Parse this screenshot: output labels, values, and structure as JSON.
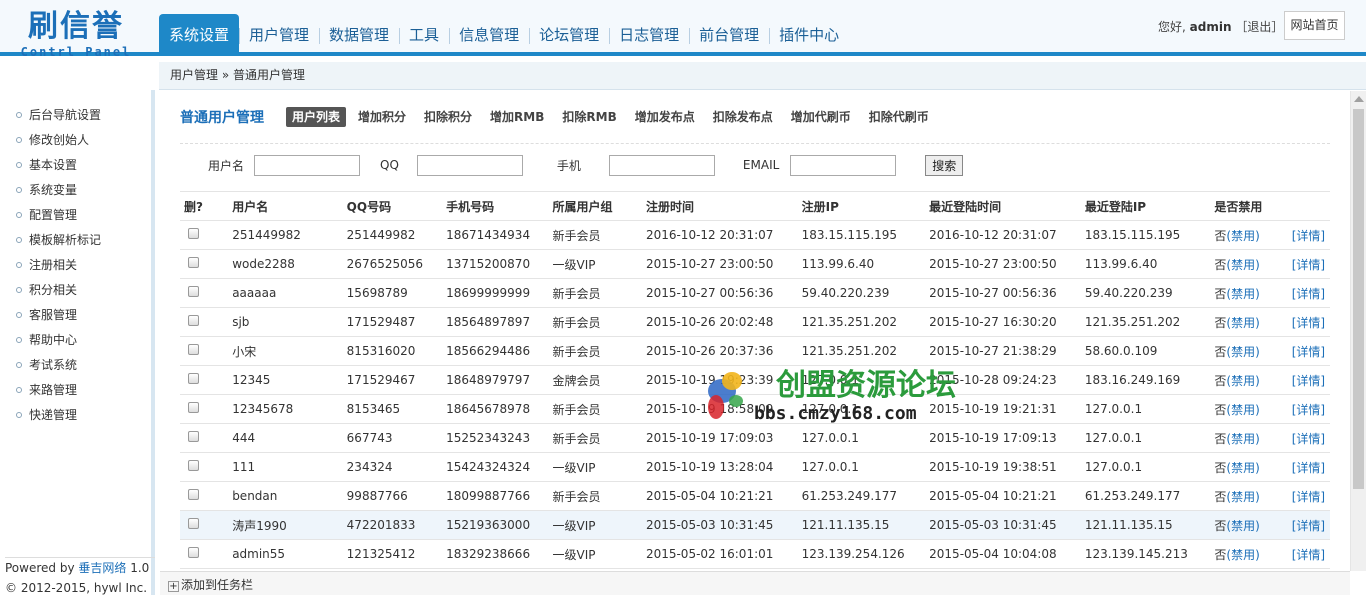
{
  "logo": {
    "main": "刷信誉",
    "sub": "Contrl Panel"
  },
  "nav": [
    "系统设置",
    "用户管理",
    "数据管理",
    "工具",
    "信息管理",
    "论坛管理",
    "日志管理",
    "前台管理",
    "插件中心"
  ],
  "user": {
    "greeting": "您好,",
    "name": "admin",
    "logout": "［退出］",
    "home": "网站首页"
  },
  "breadcrumb": "用户管理 » 普通用户管理",
  "sidebar": [
    "后台导航设置",
    "修改创始人",
    "基本设置",
    "系统变量",
    "配置管理",
    "模板解析标记",
    "注册相关",
    "积分相关",
    "客服管理",
    "帮助中心",
    "考试系统",
    "来路管理",
    "快递管理"
  ],
  "footer": {
    "powered": "Powered by",
    "brand": "垂吉网络",
    "version": " 1.0",
    "copyright": "© 2012-2015, hywl Inc."
  },
  "page": {
    "title": "普通用户管理",
    "tabs": [
      "用户列表",
      "增加积分",
      "扣除积分",
      "增加RMB",
      "扣除RMB",
      "增加发布点",
      "扣除发布点",
      "增加代刷币",
      "扣除代刷币"
    ]
  },
  "search": {
    "labels": [
      "用户名",
      "QQ",
      "手机",
      "EMAIL"
    ],
    "button": "搜索"
  },
  "table": {
    "headers": [
      "删?",
      "用户名",
      "QQ号码",
      "手机号码",
      "所属用户组",
      "注册时间",
      "注册IP",
      "最近登陆时间",
      "最近登陆IP",
      "是否禁用",
      ""
    ],
    "rows": [
      [
        "251449982",
        "251449982",
        "18671434934",
        "新手会员",
        "2016-10-12 20:31:07",
        "183.15.115.195",
        "2016-10-12 20:31:07",
        "183.15.115.195"
      ],
      [
        "wode2288",
        "2676525056",
        "13715200870",
        "一级VIP",
        "2015-10-27 23:00:50",
        "113.99.6.40",
        "2015-10-27 23:00:50",
        "113.99.6.40"
      ],
      [
        "aaaaaa",
        "15698789",
        "18699999999",
        "新手会员",
        "2015-10-27 00:56:36",
        "59.40.220.239",
        "2015-10-27 00:56:36",
        "59.40.220.239"
      ],
      [
        "sjb",
        "171529487",
        "18564897897",
        "新手会员",
        "2015-10-26 20:02:48",
        "121.35.251.202",
        "2015-10-27 16:30:20",
        "121.35.251.202"
      ],
      [
        "小宋",
        "815316020",
        "18566294486",
        "新手会员",
        "2015-10-26 20:37:36",
        "121.35.251.202",
        "2015-10-27 21:38:29",
        "58.60.0.109"
      ],
      [
        "12345",
        "171529467",
        "18648979797",
        "金牌会员",
        "2015-10-19 19:23:39",
        "127.0.0.1",
        "2015-10-28 09:24:23",
        "183.16.249.169"
      ],
      [
        "12345678",
        "8153465",
        "18645678978",
        "新手会员",
        "2015-10-19 18:58:09",
        "127.0.0.1",
        "2015-10-19 19:21:31",
        "127.0.0.1"
      ],
      [
        "444",
        "667743",
        "15252343243",
        "新手会员",
        "2015-10-19 17:09:03",
        "127.0.0.1",
        "2015-10-19 17:09:13",
        "127.0.0.1"
      ],
      [
        "111",
        "234324",
        "15424324324",
        "一级VIP",
        "2015-10-19 13:28:04",
        "127.0.0.1",
        "2015-10-19 19:38:51",
        "127.0.0.1"
      ],
      [
        "bendan",
        "99887766",
        "18099887766",
        "新手会员",
        "2015-05-04 10:21:21",
        "61.253.249.177",
        "2015-05-04 10:21:21",
        "61.253.249.177"
      ],
      [
        "涛声1990",
        "472201833",
        "15219363000",
        "一级VIP",
        "2015-05-03 10:31:45",
        "121.11.135.15",
        "2015-05-03 10:31:45",
        "121.11.135.15"
      ],
      [
        "admin55",
        "121325412",
        "18329238666",
        "一级VIP",
        "2015-05-02 16:01:01",
        "123.139.254.126",
        "2015-05-04 10:04:08",
        "123.139.145.213"
      ]
    ],
    "status_prefix": "否",
    "ban_link": "(禁用)",
    "detail_link": "[详情]",
    "highlight_row": 10
  },
  "watermark": {
    "title": "创盟资源论坛",
    "url": "bbs.cmzy168.com"
  },
  "taskbar": {
    "add": "添加到任务栏"
  },
  "colors": {
    "accent": "#1e88c8",
    "link": "#1c6fb8"
  }
}
